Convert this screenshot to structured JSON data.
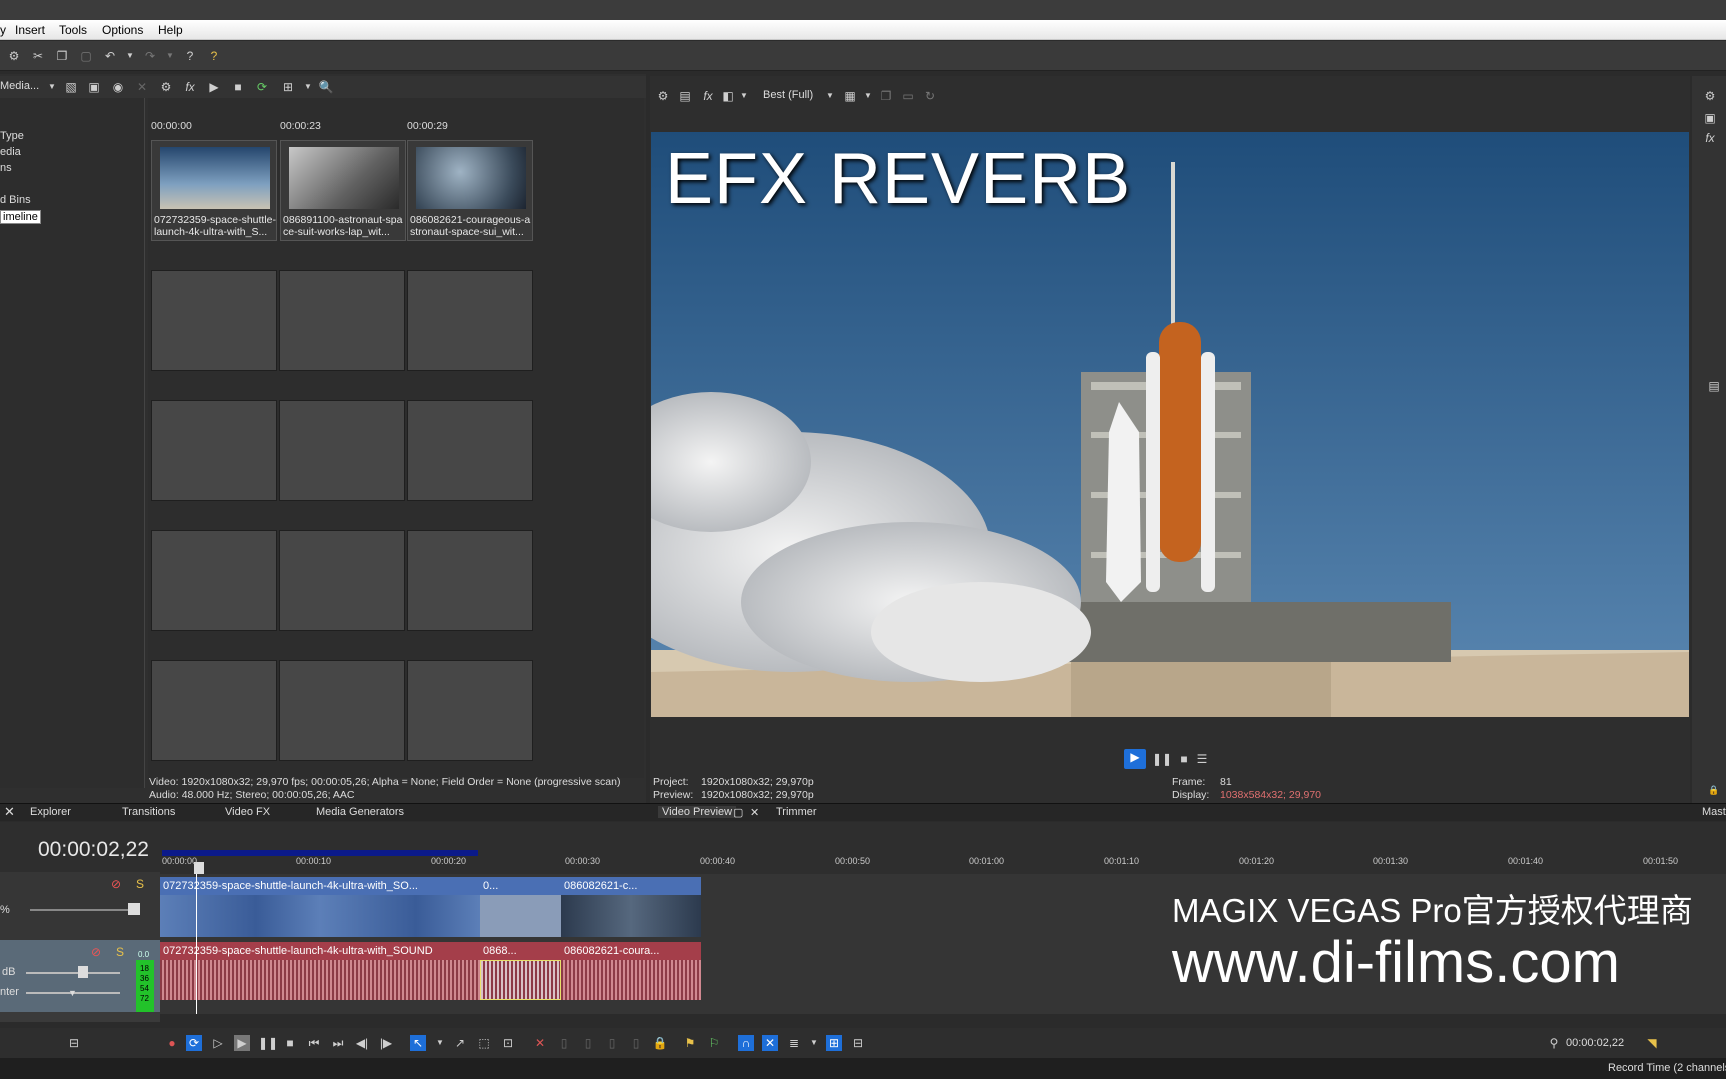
{
  "menu": {
    "items": [
      "Insert",
      "Tools",
      "Options",
      "Help"
    ]
  },
  "media_pane": {
    "dropdown_label": "Media...",
    "tree_items": [
      "Type",
      "edia",
      "ns",
      "d Bins",
      "imeline"
    ],
    "timestamps": [
      "00:00:00",
      "00:00:23",
      "00:00:29"
    ],
    "clips": [
      "072732359-space-shuttle-launch-4k-ultra-with_S...",
      "086891100-astronaut-space-suit-works-lap_wit...",
      "086082621-courageous-astronaut-space-sui_wit..."
    ],
    "info_video": "Video: 1920x1080x32; 29,970 fps; 00:00:05,26; Alpha = None; Field Order = None (progressive scan)",
    "info_audio": "Audio: 48.000 Hz; Stereo; 00:00:05,26; AAC"
  },
  "preview": {
    "quality": "Best (Full)",
    "overlay_title": "EFX REVERB",
    "project_label": "Project:",
    "project_value": "1920x1080x32; 29,970p",
    "preview_label": "Preview:",
    "preview_value": "1920x1080x32; 29,970p",
    "frame_label": "Frame:",
    "frame_value": "81",
    "display_label": "Display:",
    "display_value": "1038x584x32; 29,970"
  },
  "tabs": {
    "explorer": "Explorer",
    "transitions": "Transitions",
    "video_fx": "Video FX",
    "media_generators": "Media Generators",
    "video_preview": "Video Preview",
    "trimmer": "Trimmer",
    "master": "Mast"
  },
  "timeline": {
    "timecode": "00:00:02,22",
    "ruler": [
      "00:00:00",
      "00:00:10",
      "00:00:20",
      "00:00:30",
      "00:00:40",
      "00:00:50",
      "00:01:00",
      "00:01:10",
      "00:01:20",
      "00:01:30",
      "00:01:40",
      "00:01:50"
    ],
    "video_track": {
      "level_label": "%",
      "clips": [
        "072732359-space-shuttle-launch-4k-ultra-with_SO...",
        "0...",
        "086082621-c..."
      ]
    },
    "audio_track": {
      "db_label": "dB",
      "pan_label": "nter",
      "meter_labels": [
        "0.0",
        "18",
        "36",
        "54",
        "72"
      ],
      "clips": [
        "072732359-space-shuttle-launch-4k-ultra-with_SOUND",
        "0868...",
        "086082621-coura..."
      ]
    },
    "cursor_time": "00:00:02,22",
    "status": "Record Time (2 channels"
  },
  "watermark": {
    "line1": "MAGIX VEGAS Pro官方授权代理商",
    "line2": "www.di-films.com"
  },
  "colors": {
    "accent_blue": "#1e6fd9",
    "video_clip": "#4a6fb4",
    "audio_clip": "#b3505a",
    "display_value": "#e07070"
  }
}
